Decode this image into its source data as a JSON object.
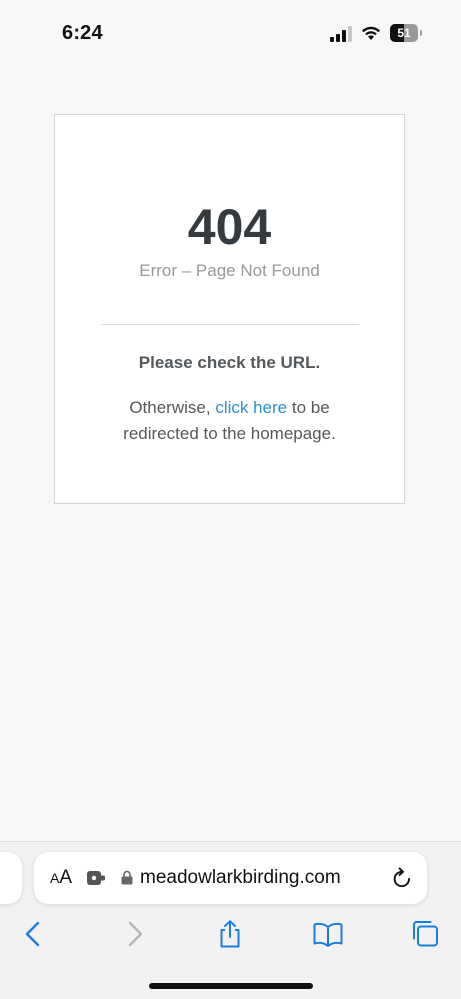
{
  "status_bar": {
    "time": "6:24",
    "battery_level": "51",
    "battery_fraction": 0.51,
    "icons": [
      "signal-icon",
      "wifi-icon",
      "battery-icon"
    ]
  },
  "error_page": {
    "code": "404",
    "subtitle": "Error – Page Not Found",
    "check_message": "Please check the URL.",
    "redirect_prefix": "Otherwise, ",
    "redirect_link": "click here",
    "redirect_suffix": " to be redirected to the homepage.",
    "link_color": "#2b8fd6"
  },
  "browser": {
    "reader_small": "A",
    "reader_large": "A",
    "url": "meadowlarkbirding.com",
    "icons": [
      "extension-icon",
      "lock-icon",
      "reload-icon"
    ],
    "toolbar": [
      "back-icon",
      "forward-icon",
      "share-icon",
      "bookmarks-icon",
      "tabs-icon"
    ],
    "accent_color": "#1a7de0"
  }
}
